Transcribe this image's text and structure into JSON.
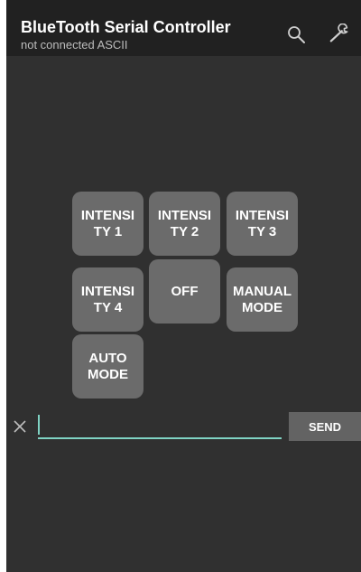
{
  "action_bar": {
    "title": "BlueTooth Serial Controller",
    "subtitle": "not connected  ASCII",
    "icons": [
      "search-icon",
      "wrench-icon"
    ]
  },
  "buttons": [
    {
      "label": "INTENSI\nTY 1"
    },
    {
      "label": "INTENSI\nTY 2"
    },
    {
      "label": "INTENSI\nTY 3"
    },
    {
      "label": "INTENSI\nTY 4"
    },
    {
      "label": "OFF"
    },
    {
      "label": "MANUAL\nMODE"
    },
    {
      "label": "AUTO\nMODE"
    }
  ],
  "input": {
    "value": "",
    "placeholder": ""
  },
  "send_label": "SEND",
  "colors": {
    "background": "#303030",
    "action_bar": "#212121",
    "button": "#6b6b6b",
    "accent": "#7fd3c3"
  }
}
